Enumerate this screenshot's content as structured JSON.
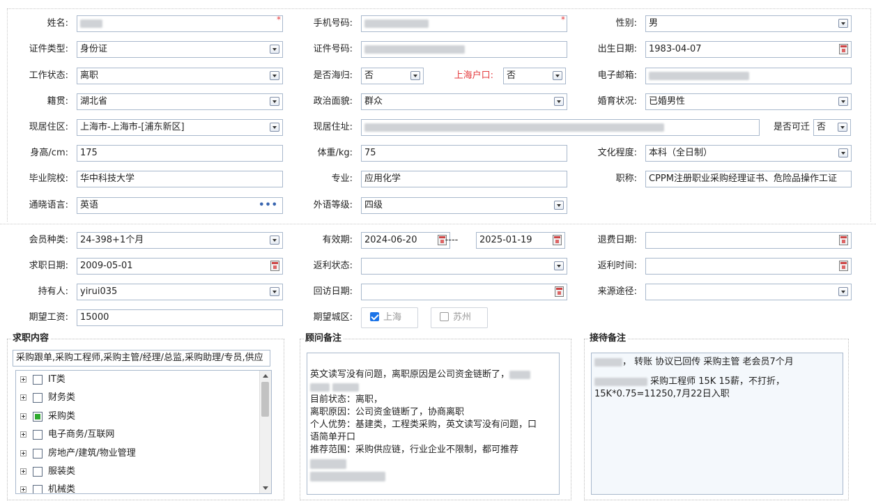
{
  "basic": {
    "name_label": "姓名:",
    "phone_label": "手机号码:",
    "gender_label": "性别:",
    "gender_value": "男",
    "required_mark": "*",
    "id_type_label": "证件类型:",
    "id_type_value": "身份证",
    "id_no_label": "证件号码:",
    "birth_label": "出生日期:",
    "birth_value": "1983-04-07",
    "work_status_label": "工作状态:",
    "work_status_value": "离职",
    "returnee_label": "是否海归:",
    "returnee_value": "否",
    "hukou_label": "上海户口:",
    "hukou_value": "否",
    "email_label": "电子邮箱:",
    "native_label": "籍贯:",
    "native_value": "湖北省",
    "political_label": "政治面貌:",
    "political_value": "群众",
    "marital_label": "婚育状况:",
    "marital_value": "已婚男性",
    "area_label": "现居住区:",
    "area_value": "上海市-上海市-[浦东新区]",
    "address_label": "现居住址:",
    "relocate_label": "是否可迁",
    "relocate_value": "否",
    "height_label": "身高/cm:",
    "height_value": "175",
    "weight_label": "体重/kg:",
    "weight_value": "75",
    "education_label": "文化程度:",
    "education_value": "本科（全日制）",
    "school_label": "毕业院校:",
    "school_value": "华中科技大学",
    "major_label": "专业:",
    "major_value": "应用化学",
    "title_label": "职称:",
    "title_value": "CPPM注册职业采购经理证书、危险品操作工证",
    "language_label": "通晓语言:",
    "language_value": "英语",
    "lang_level_label": "外语等级:",
    "lang_level_value": "四级"
  },
  "member": {
    "type_label": "会员种类:",
    "type_value": "24-398+1个月",
    "valid_label": "有效期:",
    "valid_from": "2024-06-20",
    "valid_sep": "----",
    "valid_to": "2025-01-19",
    "refund_label": "退费日期:",
    "job_date_label": "求职日期:",
    "job_date_value": "2009-05-01",
    "rebate_status_label": "返利状态:",
    "rebate_time_label": "返利时间:",
    "holder_label": "持有人:",
    "holder_value": "yirui035",
    "visit_label": "回访日期:",
    "source_label": "来源途径:",
    "salary_label": "期望工资:",
    "salary_value": "15000",
    "city_label": "期望城区:",
    "city_shanghai": "上海",
    "city_suzhou": "苏州"
  },
  "job_panel": {
    "title": "求职内容",
    "summary": "采购跟单,采购工程师,采购主管/经理/总监,采购助理/专员,供应",
    "items": [
      {
        "label": "IT类",
        "checked": false
      },
      {
        "label": "财务类",
        "checked": false
      },
      {
        "label": "采购类",
        "checked": true
      },
      {
        "label": "电子商务/互联网",
        "checked": false
      },
      {
        "label": "房地产/建筑/物业管理",
        "checked": false
      },
      {
        "label": "服装类",
        "checked": false
      },
      {
        "label": "机械类",
        "checked": false
      }
    ]
  },
  "advisor_panel": {
    "title": "顾问备注",
    "lines": [
      "英文读写没有问题，离职原因是公司资金链断了，",
      "目前状态：离职，",
      "离职原因：公司资金链断了，协商离职",
      "个人优势：基建类，工程类采购，英文读写没有问题，口",
      "语简单开口",
      "推荐范围：采购供应链，行业企业不限制，都可推荐"
    ]
  },
  "reception_panel": {
    "title": "接待备注",
    "line1": "， 转账  协议已回传 采购主管  老会员7个月",
    "line2": " 采购工程师 15K 15薪，不打折，",
    "line3": "15K*0.75=11250,7月22日入职"
  },
  "colors": {
    "border": "#a8b8cc",
    "accent_red": "#e4393c",
    "check_blue": "#1a73e8",
    "tree_green": "#2eaa2e"
  }
}
